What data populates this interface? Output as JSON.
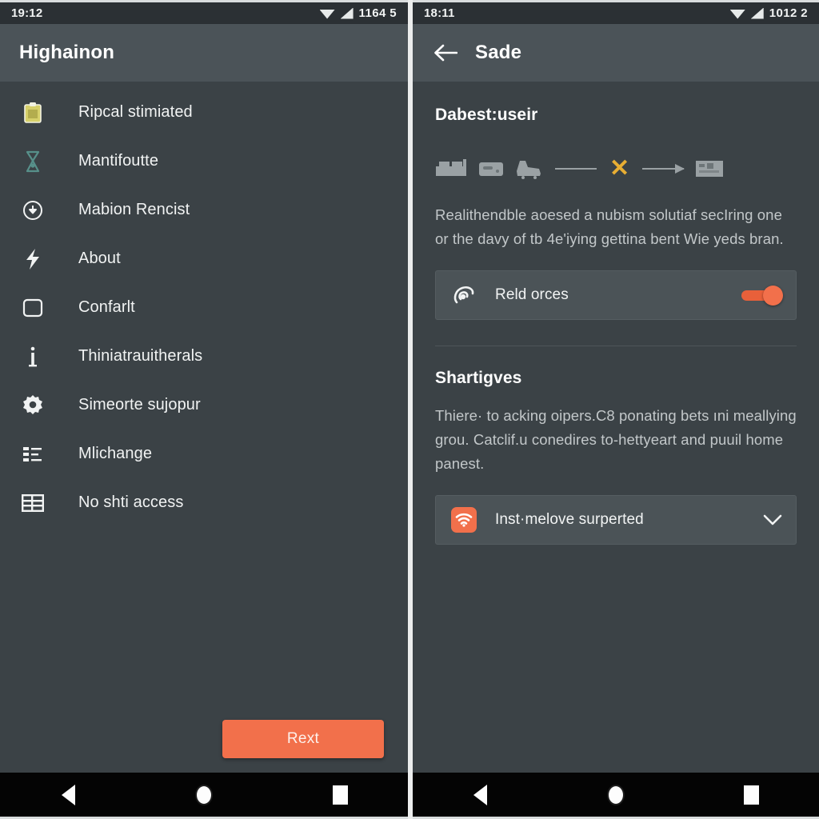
{
  "left": {
    "statusbar": {
      "time": "19:12",
      "indicators": "1164 5",
      "wifi_icon": "wifi-icon",
      "signal_icon": "signal-icon"
    },
    "appbar": {
      "title": "Highainon"
    },
    "menu_items": [
      {
        "label": "Ripcal stimiated",
        "icon": "clipboard-icon"
      },
      {
        "label": "Mantifoutte",
        "icon": "hourglass-icon"
      },
      {
        "label": "Mabion Rencist",
        "icon": "download-circle-icon"
      },
      {
        "label": "About",
        "icon": "bolt-icon"
      },
      {
        "label": "Confarlt",
        "icon": "tablet-icon"
      },
      {
        "label": "Thiniatrauitherals",
        "icon": "info-icon"
      },
      {
        "label": "Simeorte sujopur",
        "icon": "gear-icon"
      },
      {
        "label": "Mlichange",
        "icon": "list-icon"
      },
      {
        "label": "No shti access",
        "icon": "table-icon"
      }
    ],
    "primary_button": {
      "label": "Rext",
      "color": "#f2704b"
    }
  },
  "right": {
    "statusbar": {
      "time": "18:11",
      "indicators": "1012 2",
      "wifi_icon": "wifi-icon",
      "signal_icon": "signal-icon"
    },
    "appbar": {
      "title": "Sade",
      "back_icon": "back-arrow-icon"
    },
    "section_one": {
      "title": "Dabest:useir",
      "icon_flow": {
        "x_mark": "✕",
        "x_color": "#e8ae33",
        "items": [
          "device-icon",
          "device-icon",
          "shoe-icon",
          "flow-line",
          "x-mark",
          "flow-arrow",
          "card-icon"
        ]
      },
      "body": "Realithendble aoesed a nubism solutiaf secIring one or the davy of tb 4e'iying gettina bent Wie yeds bran.",
      "toggle_row": {
        "label": "Reld orces",
        "icon": "swirl-icon",
        "state": "on",
        "accent": "#f2704b"
      }
    },
    "section_two": {
      "title": "Shartigves",
      "body": "Thiere· to acking oipers.C8 ponating bets ıni meallying grou. Catclif.u conedires to-hettyeart and puuil home panest.",
      "dropdown_row": {
        "label": "Inst·melove surperted",
        "icon": "wifi-tile-icon",
        "chevron": "chevron-down-icon",
        "accent": "#f2704b"
      }
    }
  },
  "navbar": {
    "back": "nav-back-icon",
    "home": "nav-home-icon",
    "recents": "nav-recents-icon"
  }
}
